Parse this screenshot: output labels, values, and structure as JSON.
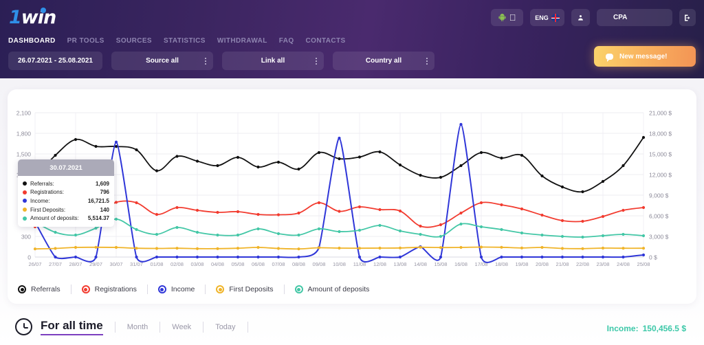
{
  "brand": {
    "name_1": "1",
    "name_win": "win"
  },
  "nav": {
    "items": [
      {
        "label": "DASHBOARD",
        "active": true
      },
      {
        "label": "PR TOOLS",
        "active": false
      },
      {
        "label": "SOURCES",
        "active": false
      },
      {
        "label": "STATISTICS",
        "active": false
      },
      {
        "label": "WITHDRAWAL",
        "active": false
      },
      {
        "label": "FAQ",
        "active": false
      },
      {
        "label": "CONTACTS",
        "active": false
      }
    ]
  },
  "filters": {
    "date_range": "26.07.2021 - 25.08.2021",
    "source": "Source all",
    "link": "Link all",
    "country": "Country all"
  },
  "header_right": {
    "os_icons": [
      "android-icon",
      "apple-icon"
    ],
    "language": "ENG",
    "flag": "uk-flag-icon",
    "user_icon": "person-icon",
    "account": "CPA",
    "logout_icon": "exit-icon",
    "new_message": "New message!",
    "message_icon": "chat-bubble-icon"
  },
  "tooltip": {
    "date": "30.07.2021",
    "rows": [
      {
        "label": "Referrals:",
        "value": "1,609",
        "color": "#111111"
      },
      {
        "label": "Registrations:",
        "value": "796",
        "color": "#f23b2f"
      },
      {
        "label": "Income:",
        "value": "16,721.5",
        "color": "#2f36d8"
      },
      {
        "label": "First Deposits:",
        "value": "140",
        "color": "#f0b429"
      },
      {
        "label": "Amount of deposits:",
        "value": "5,514.37",
        "color": "#43c7a6"
      }
    ]
  },
  "legend": {
    "items": [
      {
        "label": "Referrals",
        "color": "#111111"
      },
      {
        "label": "Registrations",
        "color": "#f23b2f"
      },
      {
        "label": "Income",
        "color": "#2f36d8"
      },
      {
        "label": "First Deposits",
        "color": "#f0b429"
      },
      {
        "label": "Amount of deposits",
        "color": "#43c7a6"
      }
    ]
  },
  "bottom": {
    "clock_icon": "clock-icon",
    "active_period": "For all time",
    "periods": [
      "Month",
      "Week",
      "Today"
    ],
    "income_label": "Income:",
    "income_value": "150,456.5 $",
    "income_color": "#3dc8a8"
  },
  "chart_data": {
    "type": "line",
    "title": "",
    "xlabel": "",
    "ylabel": "",
    "grid": true,
    "legend_position": "bottom",
    "x": [
      "26/07",
      "27/07",
      "28/07",
      "29/07",
      "30/07",
      "31/07",
      "01/08",
      "02/08",
      "03/08",
      "04/08",
      "05/08",
      "06/08",
      "07/08",
      "08/08",
      "09/08",
      "10/08",
      "11/08",
      "12/08",
      "13/08",
      "14/08",
      "15/08",
      "16/08",
      "17/08",
      "18/08",
      "19/08",
      "20/08",
      "21/08",
      "22/08",
      "23/08",
      "24/08",
      "25/08"
    ],
    "y_left_ticks": [
      "0",
      "300",
      "600",
      "900",
      "1,200",
      "1,500",
      "1,800",
      "2,100"
    ],
    "y_left_lim": [
      0,
      2100
    ],
    "y_right_ticks": [
      "0 $",
      "3,000 $",
      "6,000 $",
      "9,000 $",
      "12,000 $",
      "15,000 $",
      "18,000 $",
      "21,000 $"
    ],
    "y_right_lim": [
      0,
      21000
    ],
    "series": [
      {
        "name": "Referrals",
        "color": "#111111",
        "axis": "left",
        "values": [
          1160,
          1480,
          1710,
          1610,
          1609,
          1560,
          1255,
          1465,
          1395,
          1330,
          1450,
          1310,
          1380,
          1280,
          1520,
          1430,
          1455,
          1530,
          1340,
          1190,
          1160,
          1330,
          1520,
          1440,
          1480,
          1180,
          1020,
          950,
          1100,
          1330,
          1740
        ]
      },
      {
        "name": "Registrations",
        "color": "#f23b2f",
        "axis": "left",
        "values": [
          440,
          590,
          610,
          620,
          796,
          790,
          620,
          720,
          680,
          650,
          660,
          620,
          615,
          640,
          790,
          665,
          730,
          690,
          670,
          450,
          470,
          640,
          790,
          760,
          700,
          610,
          530,
          520,
          590,
          680,
          720
        ]
      },
      {
        "name": "Income",
        "color": "#2f36d8",
        "axis": "right",
        "values": [
          5100,
          0,
          0,
          0,
          16721.5,
          0,
          0,
          0,
          0,
          0,
          0,
          0,
          0,
          0,
          1400,
          17300,
          0,
          0,
          0,
          1500,
          0,
          19300,
          0,
          0,
          0,
          0,
          0,
          0,
          0,
          0,
          300
        ]
      },
      {
        "name": "First Deposits",
        "color": "#f0b429",
        "axis": "left",
        "values": [
          118,
          125,
          140,
          142,
          140,
          128,
          125,
          128,
          122,
          122,
          128,
          140,
          125,
          118,
          135,
          130,
          128,
          130,
          132,
          142,
          138,
          140,
          145,
          142,
          132,
          140,
          125,
          122,
          130,
          128,
          128
        ]
      },
      {
        "name": "Amount of deposits",
        "color": "#43c7a6",
        "axis": "right",
        "values": [
          5100,
          3600,
          3200,
          4200,
          5514.37,
          4000,
          3300,
          4300,
          3600,
          3200,
          3200,
          4100,
          3400,
          3200,
          4100,
          3700,
          3900,
          4600,
          3800,
          3300,
          3000,
          4800,
          4400,
          4000,
          3500,
          3200,
          3000,
          2900,
          3100,
          3300,
          3100
        ]
      }
    ]
  }
}
